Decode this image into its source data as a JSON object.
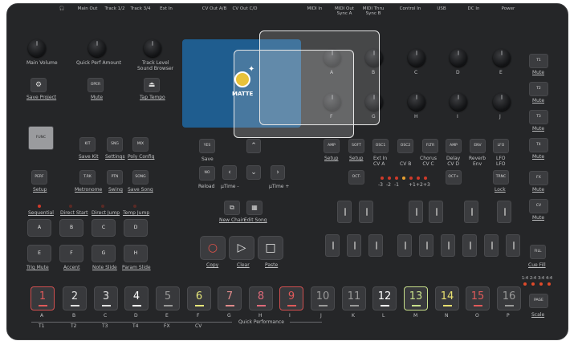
{
  "ports": [
    "Main Out",
    "Track 1/2",
    "Track 3/4",
    "Ext In",
    "CV Out A/B",
    "CV Out C/D",
    "MIDI In",
    "MIDI Out\nSync A",
    "MIDI Thru\nSync B",
    "Control In",
    "USB",
    "DC In",
    "Power"
  ],
  "left": {
    "knob_labels": [
      "Main Volume",
      "Quick Perf Amount",
      "Track Level"
    ],
    "sound_browser": "Sound Browser",
    "save_project": "Save Project",
    "oper_button": "OPER",
    "mute": "Mute",
    "tap_tempo": "Tap Tempo",
    "func_button": "FUNC",
    "perf_button": "PERF",
    "setup": "Setup",
    "row1_btns": [
      "KIT",
      "SNG",
      "MIX"
    ],
    "row1_labels": [
      "Save Kit",
      "Settings",
      "Poly Config"
    ],
    "row2_btns": [
      "T.RK",
      "PTN",
      "SONG"
    ],
    "row2_labels": [
      "Metronome",
      "Swing",
      "Save Song"
    ],
    "seq_labels": [
      "Sequential",
      "Direct Start",
      "Direct Jump",
      "Temp Jump"
    ],
    "abcd": [
      "A",
      "B",
      "C",
      "D"
    ],
    "efgh": [
      "E",
      "F",
      "G",
      "H"
    ],
    "bottom_labels": [
      "Trig Mute",
      "Accent",
      "Note Slide",
      "Param Slide"
    ]
  },
  "center": {
    "yes": "YES",
    "save": "Save",
    "no": "NO",
    "reload": "Reload",
    "utime_minus": "µTime -",
    "utime_plus": "µTime +",
    "new_chain": "New Chain",
    "edit_song": "Edit Song",
    "copy": "Copy",
    "clear": "Clear",
    "paste": "Paste",
    "overlay_label": "MATTE"
  },
  "right": {
    "knob_letters": [
      "A",
      "B",
      "C",
      "D",
      "E",
      "F",
      "G",
      "H",
      "I",
      "J"
    ],
    "page_btns": [
      "AMP",
      "SOFT",
      "OSC1",
      "OSC2",
      "FLTR",
      "AMP",
      "ENV",
      "LFO"
    ],
    "page_labels_top": [
      "Setup",
      "Setup",
      "Ext In\nCV A",
      "CV B",
      "Chorus\nCV C",
      "Delay\nCV D",
      "Reverb\nEnv",
      "LFO\nLFO"
    ],
    "oct_minus": "OCT-",
    "oct_plus": "OCT+",
    "oct_values": [
      "-3",
      "-2",
      "-1",
      "+1",
      "+2",
      "+3"
    ],
    "trnc": "TRNC",
    "lock": "Lock",
    "track_btns": [
      "T1",
      "T2",
      "T3",
      "T4",
      "FX",
      "CV"
    ],
    "mute": "Mute",
    "fill": "FILL",
    "cue_fill": "Cue Fill",
    "page_btn": "PAGE",
    "scale": "Scale",
    "page_leds": [
      "1:4",
      "2:4",
      "3:4",
      "4:4"
    ]
  },
  "steps": {
    "numbers": [
      "1",
      "2",
      "3",
      "4",
      "5",
      "6",
      "7",
      "8",
      "9",
      "10",
      "11",
      "12",
      "13",
      "14",
      "15",
      "16"
    ],
    "letters": [
      "A",
      "B",
      "C",
      "D",
      "E",
      "F",
      "G",
      "H",
      "I",
      "J",
      "K",
      "L",
      "M",
      "N",
      "O",
      "P"
    ],
    "tracks": [
      "T1",
      "T2",
      "T3",
      "T4",
      "FX",
      "CV"
    ],
    "quick_performance": "Quick Performance",
    "colors": [
      "#e05a5a",
      "#e0e0e0",
      "#e0e0e0",
      "#ffffff",
      "#9a9a9a",
      "#e6e67a",
      "#e08a8a",
      "#e06a7a",
      "#e05a5a",
      "#9a9a9a",
      "#9a9a9a",
      "#ffffff",
      "#c8e08a",
      "#e8e070",
      "#e05a5a",
      "#9a9a9a"
    ]
  }
}
